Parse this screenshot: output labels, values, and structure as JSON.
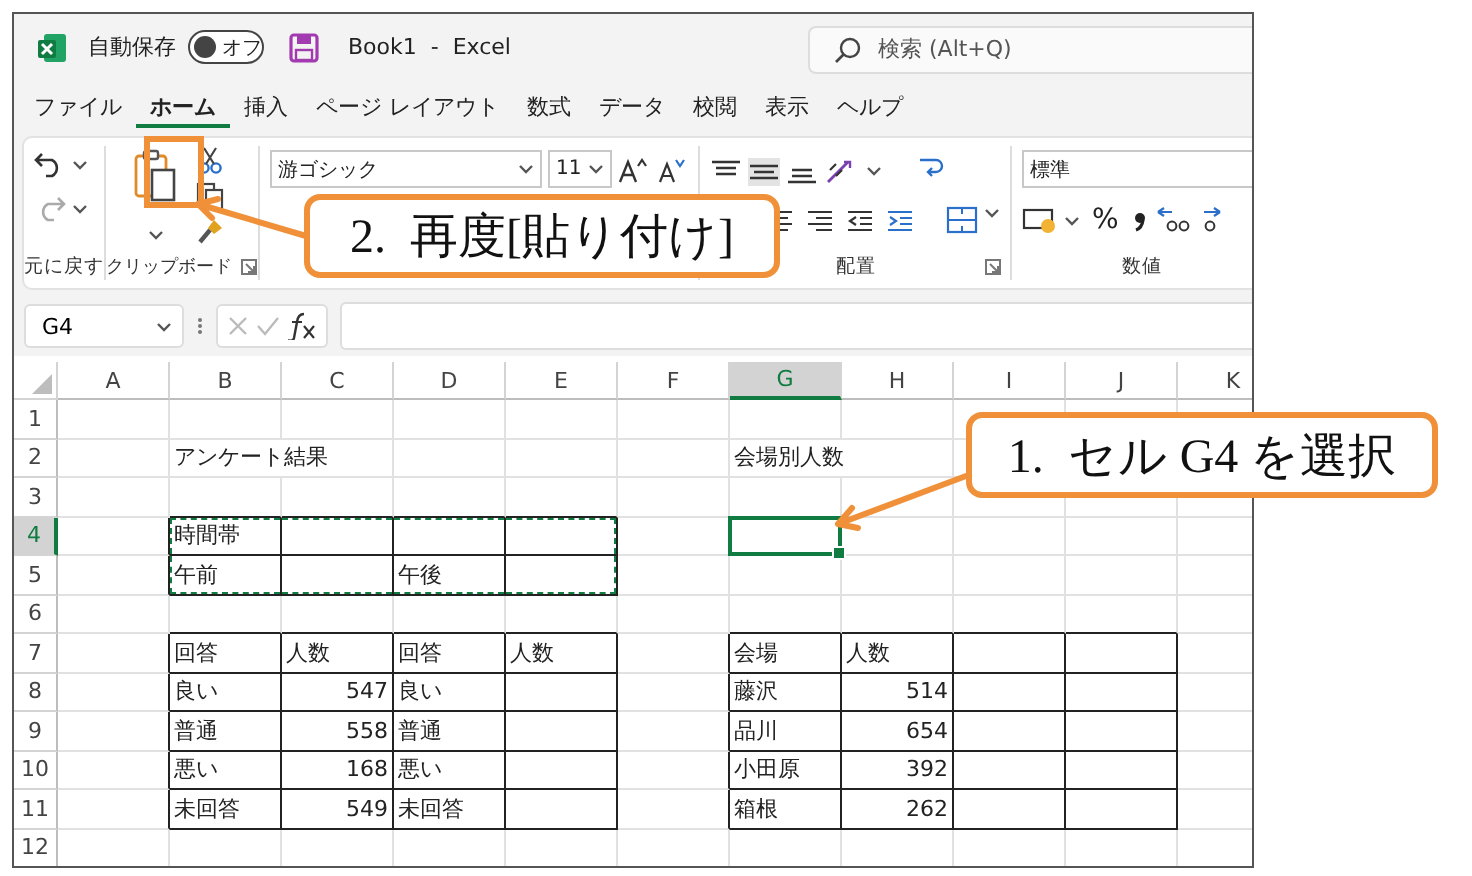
{
  "title_bar": {
    "autosave_label": "自動保存",
    "autosave_toggle": {
      "label": "オフ",
      "on": false
    },
    "document_title": "Book1  -  Excel",
    "search": {
      "placeholder": "検索 (Alt+Q)"
    }
  },
  "menu_tabs": [
    {
      "label": "ファイル",
      "selected": false
    },
    {
      "label": "ホーム",
      "selected": true
    },
    {
      "label": "挿入",
      "selected": false
    },
    {
      "label": "ページ レイアウト",
      "selected": false
    },
    {
      "label": "数式",
      "selected": false
    },
    {
      "label": "データ",
      "selected": false
    },
    {
      "label": "校閲",
      "selected": false
    },
    {
      "label": "表示",
      "selected": false
    },
    {
      "label": "ヘルプ",
      "selected": false
    }
  ],
  "ribbon": {
    "groups": [
      {
        "kind": "undo",
        "label": "元に戻す"
      },
      {
        "kind": "clipboard",
        "label": "クリップボード",
        "launcher": true
      },
      {
        "kind": "font",
        "font_name": "游ゴシック",
        "font_size": "11"
      },
      {
        "kind": "alignment",
        "label": "配置",
        "launcher": true
      },
      {
        "kind": "number",
        "label": "数値",
        "number_format": "標準",
        "percent": "%"
      }
    ]
  },
  "formula_bar": {
    "name_box": "G4"
  },
  "sheet": {
    "columns": [
      {
        "label": "A",
        "selected": false
      },
      {
        "label": "B",
        "selected": false
      },
      {
        "label": "C",
        "selected": false
      },
      {
        "label": "D",
        "selected": false
      },
      {
        "label": "E",
        "selected": false
      },
      {
        "label": "F",
        "selected": false
      },
      {
        "label": "G",
        "selected": true
      },
      {
        "label": "H",
        "selected": false
      },
      {
        "label": "I",
        "selected": false
      },
      {
        "label": "J",
        "selected": false
      },
      {
        "label": "K",
        "selected": false
      }
    ],
    "rows": [
      {
        "header": "1",
        "selected": false
      },
      {
        "header": "2",
        "selected": false,
        "cells": [
          "",
          "アンケート結果",
          "",
          "",
          "",
          "",
          "会場別人数"
        ]
      },
      {
        "header": "3",
        "selected": false
      },
      {
        "header": "4",
        "selected": true,
        "cells": [
          "",
          "時間帯"
        ],
        "bordered": [
          false,
          true,
          true,
          true,
          true
        ],
        "copied": [
          false,
          true,
          true,
          true,
          true
        ]
      },
      {
        "header": "5",
        "selected": false,
        "cells": [
          "",
          "午前",
          "",
          "午後"
        ],
        "bordered": [
          false,
          true,
          true,
          true,
          true
        ],
        "copied": [
          false,
          true,
          true,
          true,
          true
        ]
      },
      {
        "header": "6",
        "selected": false
      },
      {
        "header": "7",
        "selected": false,
        "cells": [
          "",
          "回答",
          "人数",
          "回答",
          "人数",
          "",
          "会場",
          "人数"
        ],
        "bordered": [
          false,
          true,
          true,
          true,
          true,
          false,
          true,
          true,
          true,
          true
        ]
      },
      {
        "header": "8",
        "selected": false,
        "cells": [
          "",
          "良い",
          "547",
          "良い",
          "",
          "",
          "藤沢",
          "514"
        ],
        "bordered": [
          false,
          true,
          true,
          true,
          true,
          false,
          true,
          true,
          true,
          true
        ]
      },
      {
        "header": "9",
        "selected": false,
        "cells": [
          "",
          "普通",
          "558",
          "普通",
          "",
          "",
          "品川",
          "654"
        ],
        "bordered": [
          false,
          true,
          true,
          true,
          true,
          false,
          true,
          true,
          true,
          true
        ]
      },
      {
        "header": "10",
        "selected": false,
        "cells": [
          "",
          "悪い",
          "168",
          "悪い",
          "",
          "",
          "小田原",
          "392"
        ],
        "bordered": [
          false,
          true,
          true,
          true,
          true,
          false,
          true,
          true,
          true,
          true
        ]
      },
      {
        "header": "11",
        "selected": false,
        "cells": [
          "",
          "未回答",
          "549",
          "未回答",
          "",
          "",
          "箱根",
          "262"
        ],
        "bordered": [
          false,
          true,
          true,
          true,
          true,
          false,
          true,
          true,
          true,
          true
        ]
      },
      {
        "header": "12",
        "selected": false
      }
    ]
  },
  "callouts": [
    {
      "kind": "paste",
      "text": "2.  再度[貼り付け]"
    },
    {
      "kind": "cell",
      "text": "1.  セル G4 を選択"
    }
  ]
}
